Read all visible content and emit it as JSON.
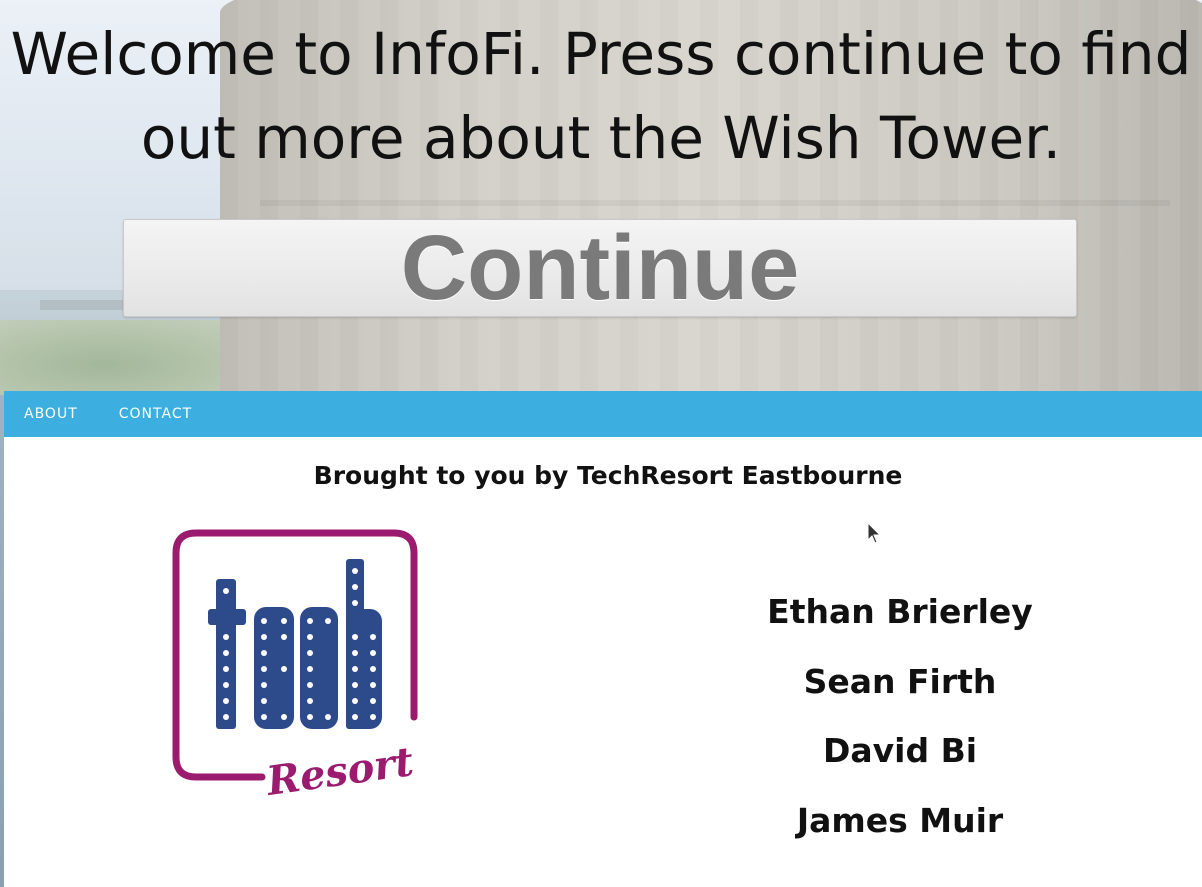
{
  "hero": {
    "title_line1": "Welcome to InfoFi. Press continue to find",
    "title_line2": "out more about the Wish Tower.",
    "continue_label": "Continue"
  },
  "nav": {
    "items": [
      {
        "label": "ABOUT"
      },
      {
        "label": "CONTACT"
      }
    ],
    "color": "#3caedf"
  },
  "content": {
    "brought_by": "Brought to you by TechResort Eastbourne",
    "logo": {
      "word_top": "tech",
      "word_bottom": "Resort",
      "frame_color": "#9b1b6f",
      "letters_color": "#2d4a8a"
    },
    "names": [
      "Ethan Brierley",
      "Sean Firth",
      "David Bi",
      "James Muir"
    ]
  }
}
